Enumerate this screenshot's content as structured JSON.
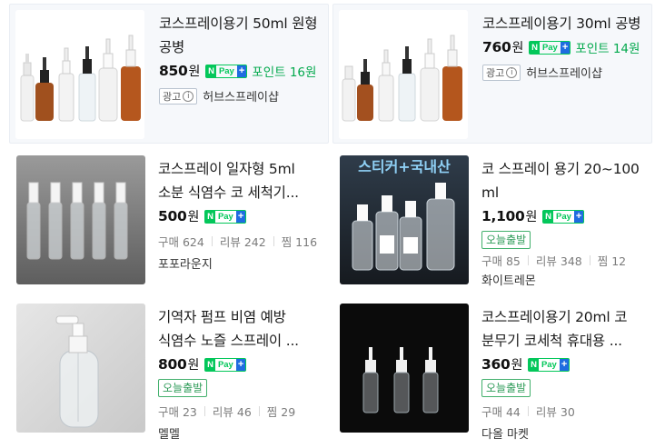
{
  "products": [
    {
      "title": "코스프레이용기 50ml 원형 공병",
      "price": "850",
      "currency": "원",
      "npay": {
        "n": "N",
        "pay": "Pay",
        "plus": "+"
      },
      "points": "포인트 16원",
      "ad_label": "광고",
      "ad_info_icon": "i",
      "seller": "허브스프레이샵"
    },
    {
      "title": "코스프레이용기 30ml 공병",
      "price": "760",
      "currency": "원",
      "npay": {
        "n": "N",
        "pay": "Pay",
        "plus": "+"
      },
      "points": "포인트 14원",
      "ad_label": "광고",
      "ad_info_icon": "i",
      "seller": "허브스프레이샵"
    },
    {
      "title_line1": "코스프레이 일자형 5ml",
      "title_line2": "소분 식염수 코 세척기...",
      "price": "500",
      "currency": "원",
      "npay": {
        "n": "N",
        "pay": "Pay",
        "plus": "+"
      },
      "purchases": "구매 624",
      "reviews": "리뷰 242",
      "wishes": "찜 116",
      "seller": "포포라운지"
    },
    {
      "title": "코 스프레이 용기 20~100ml",
      "price": "1,100",
      "currency": "원",
      "npay": {
        "n": "N",
        "pay": "Pay",
        "plus": "+"
      },
      "badge": "오늘출발",
      "purchases": "구매 85",
      "reviews": "리뷰 348",
      "wishes": "찜 12",
      "seller": "화이트레몬",
      "image_banner": "스티커+국내산"
    },
    {
      "title_line1": "기역자 펌프 비염 예방",
      "title_line2": "식염수 노즐 스프레이 ...",
      "price": "800",
      "currency": "원",
      "npay": {
        "n": "N",
        "pay": "Pay",
        "plus": "+"
      },
      "badge": "오늘출발",
      "purchases": "구매 23",
      "reviews": "리뷰 46",
      "wishes": "찜 29",
      "seller": "멜멜"
    },
    {
      "title_line1": "코스프레이용기 20ml 코",
      "title_line2": "분무기 코세척 휴대용 ...",
      "price": "360",
      "currency": "원",
      "npay": {
        "n": "N",
        "pay": "Pay",
        "plus": "+"
      },
      "badge": "오늘출발",
      "purchases": "구매 44",
      "reviews": "리뷰 30",
      "seller": "다올 마켓"
    }
  ],
  "colors": {
    "naver_green": "#03c75a",
    "plus_blue": "#1f6ce0",
    "points_green": "#03a94d",
    "ad_card_bg": "#f6f8fb"
  }
}
